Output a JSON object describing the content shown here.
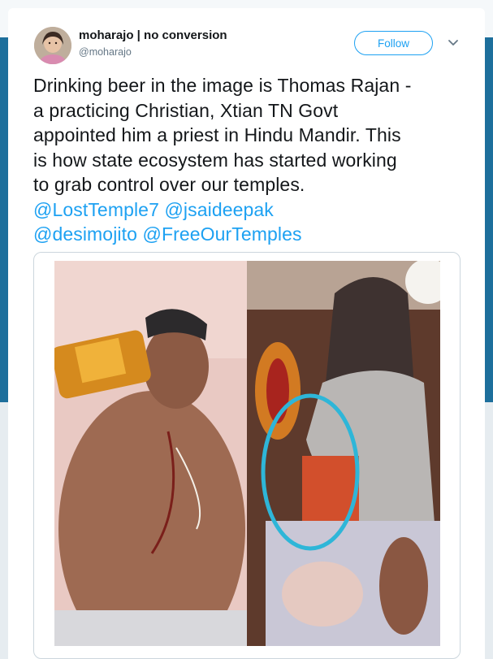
{
  "tweet": {
    "author": {
      "name": "moharajo | no conversion",
      "handle": "@moharajo"
    },
    "follow_label": "Follow",
    "text_lines": [
      "Drinking beer in the image is Thomas Rajan -",
      "a practicing Christian, Xtian TN Govt",
      "appointed him a priest in Hindu Mandir. This",
      "is how state ecosystem has started working",
      "to grab control over our temples."
    ],
    "mentions_line1": [
      "@LostTemple7",
      "@jsaideepak"
    ],
    "mentions_line2": [
      "@desimojito",
      "@FreeOurTemples"
    ],
    "colors": {
      "link": "#1da1f2",
      "text": "#14171a",
      "muted": "#657786",
      "background": "#e6ecf0"
    },
    "icons": {
      "menu": "chevron-down-icon",
      "avatar": "avatar-photo"
    }
  }
}
